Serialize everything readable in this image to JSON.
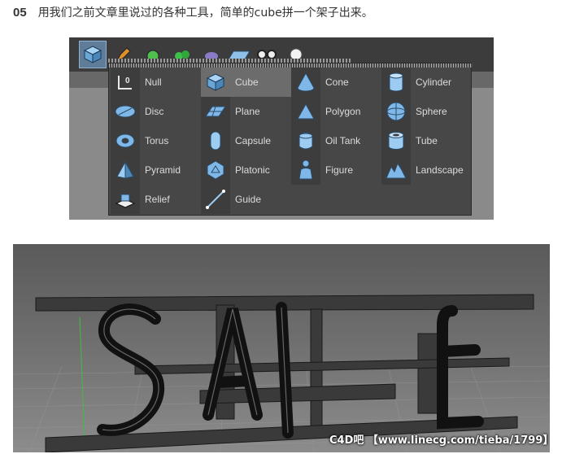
{
  "step": {
    "number": "05",
    "text": "用我们之前文章里说过的各种工具，简单的cube拼一个架子出来。"
  },
  "menu": {
    "columns": [
      [
        {
          "label": "Null",
          "icon": "null-icon"
        },
        {
          "label": "Disc",
          "icon": "disc-icon"
        },
        {
          "label": "Torus",
          "icon": "torus-icon"
        },
        {
          "label": "Pyramid",
          "icon": "pyramid-icon"
        },
        {
          "label": "Relief",
          "icon": "relief-icon"
        }
      ],
      [
        {
          "label": "Cube",
          "icon": "cube-icon",
          "highlighted": true
        },
        {
          "label": "Plane",
          "icon": "plane-icon"
        },
        {
          "label": "Capsule",
          "icon": "capsule-icon"
        },
        {
          "label": "Platonic",
          "icon": "platonic-icon"
        },
        {
          "label": "Guide",
          "icon": "guide-icon"
        }
      ],
      [
        {
          "label": "Cone",
          "icon": "cone-icon"
        },
        {
          "label": "Polygon",
          "icon": "polygon-icon"
        },
        {
          "label": "Oil Tank",
          "icon": "oil-tank-icon"
        },
        {
          "label": "Figure",
          "icon": "figure-icon"
        }
      ],
      [
        {
          "label": "Cylinder",
          "icon": "cylinder-icon"
        },
        {
          "label": "Sphere",
          "icon": "sphere-icon"
        },
        {
          "label": "Tube",
          "icon": "tube-icon"
        },
        {
          "label": "Landscape",
          "icon": "landscape-icon"
        }
      ]
    ]
  },
  "watermark": "C4D吧 【www.linecg.com/tieba/1799】",
  "colors": {
    "icon_blue": "#7fb8e8",
    "menu_bg": "#474747",
    "highlight": "#6c6c6c"
  }
}
